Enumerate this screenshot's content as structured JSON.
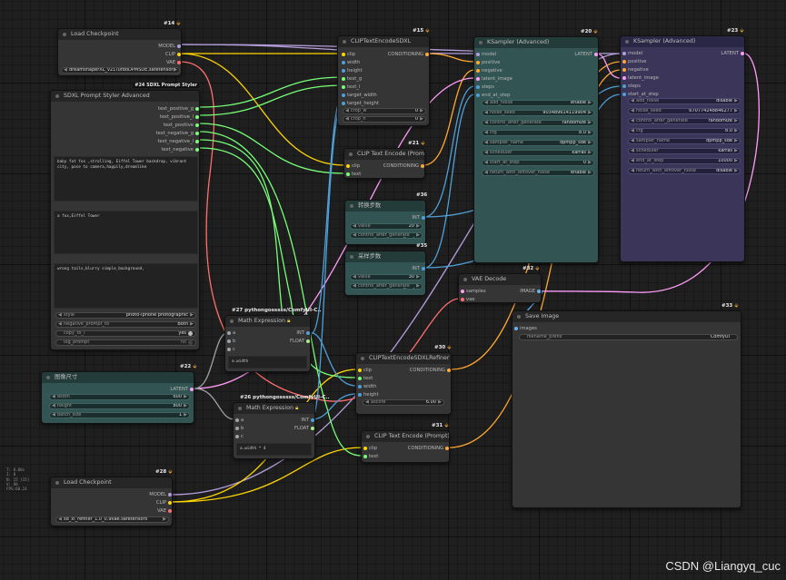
{
  "colors": {
    "model": "#b39ddb",
    "clip": "#ffd500",
    "vae": "#ff6e6e",
    "conditioning": "#ffa931",
    "latent": "#ff9cf9",
    "int": "#4fa0d8",
    "float": "#aaee88",
    "string": "#77ff77",
    "image": "#64b5f6",
    "any": "#9fa3a8"
  },
  "nodes": {
    "ckpt14": {
      "badge": "#14",
      "title": "Load Checkpoint",
      "outputs": [
        "MODEL",
        "CLIP",
        "VAE"
      ],
      "ckpt_name": "dreamshaperXL_v21TurboDPMSDE.safetensors"
    },
    "styler24": {
      "badge": "#24 SDXL Prompt Styler",
      "title": "SDXL Prompt Styler Advanced",
      "outputs": [
        "text_positive_g",
        "text_positive_l",
        "text_positive",
        "text_negative_g",
        "text_negative_l",
        "text_negative"
      ],
      "text1": "baby fat fox ,strolling, Eiffel Tower backdrop, vibrant city, pose to camera,happily,dreamlike",
      "text2": "a fox,Eiffel Tower",
      "text3": "wrong tails,blurry simple_background,",
      "widgets": [
        {
          "label": "style",
          "value": "photo-iphone photographic"
        },
        {
          "label": "negative_prompt_to",
          "value": "Both"
        },
        {
          "label": "copy_to_l",
          "value": "yes"
        },
        {
          "label": "log_prompt",
          "value": "no"
        }
      ]
    },
    "clipsdxl15": {
      "badge": "#15",
      "title": "CLIPTextEncodeSDXL",
      "inputs": [
        "clip",
        "width",
        "height",
        "text_g",
        "text_l",
        "target_width",
        "target_height"
      ],
      "outputs": [
        "CONDITIONING"
      ],
      "widgets": [
        {
          "label": "crop_w",
          "value": "0"
        },
        {
          "label": "crop_h",
          "value": "0"
        }
      ]
    },
    "cliptext21": {
      "badge": "#21",
      "title": "CLIP Text Encode (Prompt)",
      "inputs": [
        "clip",
        "text"
      ],
      "outputs": [
        "CONDITIONING"
      ]
    },
    "steps36": {
      "badge": "#36",
      "title": "转换步数",
      "outputs": [
        "INT"
      ],
      "widgets": [
        {
          "label": "value",
          "value": "20"
        },
        {
          "label": "control_after_generate",
          "value": "fixed"
        }
      ]
    },
    "steps35": {
      "badge": "#35",
      "title": "采样步数",
      "outputs": [
        "INT"
      ],
      "widgets": [
        {
          "label": "value",
          "value": "30"
        },
        {
          "label": "control_after_generate",
          "value": "fixed"
        }
      ]
    },
    "ksampler20": {
      "badge": "#20",
      "title": "KSampler (Advanced)",
      "inputs": [
        "model",
        "positive",
        "negative",
        "latent_image",
        "steps",
        "end_at_step"
      ],
      "outputs": [
        "LATENT"
      ],
      "widgets": [
        {
          "label": "add_noise",
          "value": "enable"
        },
        {
          "label": "noise_seed",
          "value": "903489614119904"
        },
        {
          "label": "control_after_generate",
          "value": "randomize"
        },
        {
          "label": "cfg",
          "value": "8.0"
        },
        {
          "label": "sampler_name",
          "value": "dpmpp_sde"
        },
        {
          "label": "scheduler",
          "value": "karras"
        },
        {
          "label": "start_at_step",
          "value": "0"
        },
        {
          "label": "return_with_leftover_noise",
          "value": "enable"
        }
      ]
    },
    "ksampler23": {
      "badge": "#23",
      "title": "KSampler (Advanced)",
      "inputs": [
        "model",
        "positive",
        "negative",
        "latent_image",
        "steps",
        "start_at_step"
      ],
      "outputs": [
        "LATENT"
      ],
      "widgets": [
        {
          "label": "add_noise",
          "value": "disable"
        },
        {
          "label": "noise_seed",
          "value": "670774248846277"
        },
        {
          "label": "control_after_generate",
          "value": "randomize"
        },
        {
          "label": "cfg",
          "value": "8.0"
        },
        {
          "label": "sampler_name",
          "value": "dpmpp_sde"
        },
        {
          "label": "scheduler",
          "value": "karras"
        },
        {
          "label": "end_at_step",
          "value": "10000"
        },
        {
          "label": "return_with_leftover_noise",
          "value": "disable"
        }
      ]
    },
    "vae32": {
      "badge": "#32",
      "title": "VAE Decode",
      "inputs": [
        "samples",
        "vae"
      ],
      "outputs": [
        "IMAGE"
      ]
    },
    "save33": {
      "badge": "#33",
      "title": "Save Image",
      "inputs": [
        "images"
      ],
      "filename_prefix_label": "filename_prefix",
      "filename_prefix": "ComfyUI"
    },
    "math27": {
      "badge": "#27 pythongosssss/ComfyUI-C..",
      "title": "Math Expression",
      "inputs": [
        "a",
        "b",
        "c"
      ],
      "outputs": [
        "INT",
        "FLOAT"
      ],
      "expression": "a.width"
    },
    "math26": {
      "badge": "#26 pythongosssss/ComfyUI-C..",
      "title": "Math Expression",
      "inputs": [
        "a",
        "b",
        "c"
      ],
      "outputs": [
        "INT",
        "FLOAT"
      ],
      "expression": "a.width * 4"
    },
    "imgsize22": {
      "badge": "#22",
      "title": "图像尺寸",
      "outputs": [
        "LATENT"
      ],
      "widgets": [
        {
          "label": "width",
          "value": "600"
        },
        {
          "label": "height",
          "value": "800"
        },
        {
          "label": "batch_size",
          "value": "1"
        }
      ]
    },
    "refiner30": {
      "badge": "#30",
      "title": "CLIPTextEncodeSDXLRefiner",
      "inputs": [
        "clip",
        "text",
        "width",
        "height"
      ],
      "outputs": [
        "CONDITIONING"
      ],
      "widgets": [
        {
          "label": "ascore",
          "value": "6.00"
        }
      ]
    },
    "cliptext31": {
      "badge": "#31",
      "title": "CLIP Text Encode (Prompt)",
      "inputs": [
        "clip",
        "text"
      ],
      "outputs": [
        "CONDITIONING"
      ]
    },
    "ckpt28": {
      "badge": "#28",
      "title": "Load Checkpoint",
      "outputs": [
        "MODEL",
        "CLIP",
        "VAE"
      ],
      "ckpt_name": "sd_xl_refiner_1.0_0.9vae.safetensors"
    }
  },
  "stats": "T: 0.00s\nI: 0\nN: 15 [15]\nV: 80\nFPS:60.24",
  "watermark": "CSDN @Liangyq_cuc"
}
